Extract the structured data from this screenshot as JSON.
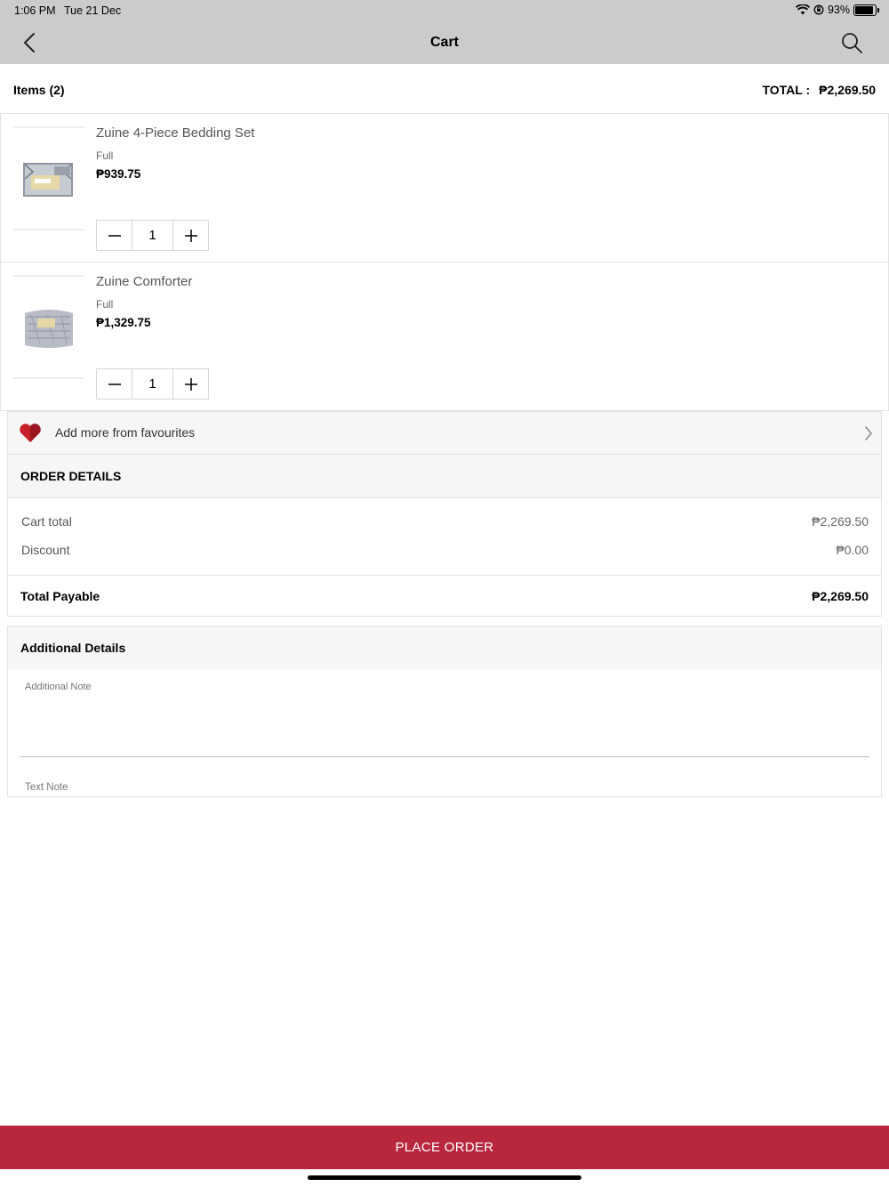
{
  "status_bar": {
    "time": "1:06 PM",
    "date": "Tue 21 Dec",
    "battery": "93%",
    "battery_level": 0.93
  },
  "nav": {
    "title": "Cart",
    "back_icon": "chevron-left-icon",
    "search_icon": "search-icon"
  },
  "items_header": {
    "count_label": "Items (2)",
    "total_label": "TOTAL :",
    "total_value": "₱2,269.50"
  },
  "cart": [
    {
      "name": "Zuine 4-Piece Bedding Set",
      "variant": "Full",
      "price": "₱939.75",
      "qty": "1"
    },
    {
      "name": "Zuine Comforter",
      "variant": "Full",
      "price": "₱1,329.75",
      "qty": "1"
    }
  ],
  "favourites": {
    "label": "Add more from favourites",
    "icon": "heart-icon"
  },
  "order_details": {
    "title": "ORDER DETAILS",
    "cart_total_label": "Cart total",
    "cart_total_value": "₱2,269.50",
    "discount_label": "Discount",
    "discount_value": "₱0.00",
    "payable_label": "Total Payable",
    "payable_value": "₱2,269.50"
  },
  "additional": {
    "title": "Additional Details",
    "note_placeholder": "Additional Note",
    "text_note": "Text Note"
  },
  "place_order": {
    "label": "PLACE ORDER"
  },
  "colors": {
    "accent": "#b9273f",
    "header": "#cbcbcb",
    "heart": "#c8202a"
  }
}
